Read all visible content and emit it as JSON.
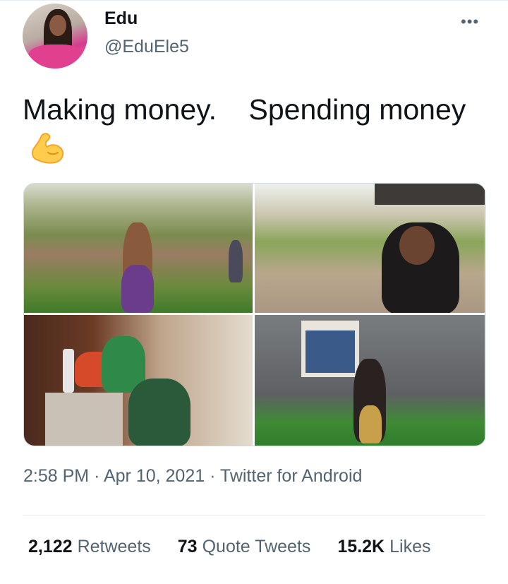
{
  "user": {
    "name": "Edu",
    "handle": "@EduEle5"
  },
  "tweet": {
    "text": "Making money.    Spending money",
    "emoji_icon": "flexed-biceps-icon"
  },
  "media": {
    "count": 4,
    "photos": [
      {
        "name": "photo-farm-field"
      },
      {
        "name": "photo-tree-shade"
      },
      {
        "name": "photo-indoor-basin"
      },
      {
        "name": "photo-building-lawn"
      }
    ]
  },
  "meta": {
    "time": "2:58 PM",
    "date": "Apr 10, 2021",
    "source": "Twitter for Android",
    "separator": "·"
  },
  "stats": {
    "retweets_count": "2,122",
    "retweets_label": "Retweets",
    "quotes_count": "73",
    "quotes_label": "Quote Tweets",
    "likes_count": "15.2K",
    "likes_label": "Likes"
  },
  "icons": {
    "more": "more-options-icon"
  },
  "colors": {
    "text_primary": "#0f1419",
    "text_secondary": "#536471",
    "border": "#cfd9de",
    "emoji": "#ffcc4d"
  }
}
